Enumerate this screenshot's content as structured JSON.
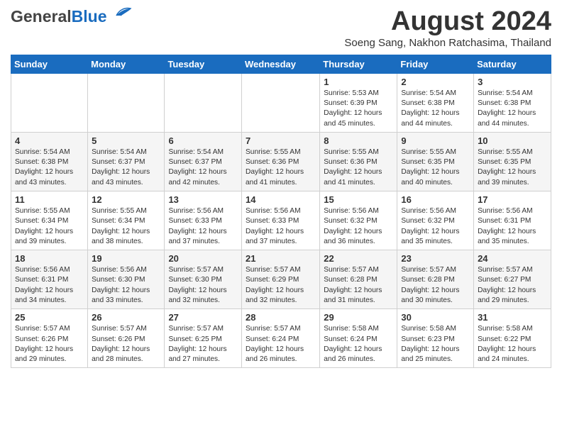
{
  "header": {
    "logo_general": "General",
    "logo_blue": "Blue",
    "month_year": "August 2024",
    "location": "Soeng Sang, Nakhon Ratchasima, Thailand"
  },
  "weekdays": [
    "Sunday",
    "Monday",
    "Tuesday",
    "Wednesday",
    "Thursday",
    "Friday",
    "Saturday"
  ],
  "weeks": [
    [
      {
        "day": "",
        "info": ""
      },
      {
        "day": "",
        "info": ""
      },
      {
        "day": "",
        "info": ""
      },
      {
        "day": "",
        "info": ""
      },
      {
        "day": "1",
        "info": "Sunrise: 5:53 AM\nSunset: 6:39 PM\nDaylight: 12 hours\nand 45 minutes."
      },
      {
        "day": "2",
        "info": "Sunrise: 5:54 AM\nSunset: 6:38 PM\nDaylight: 12 hours\nand 44 minutes."
      },
      {
        "day": "3",
        "info": "Sunrise: 5:54 AM\nSunset: 6:38 PM\nDaylight: 12 hours\nand 44 minutes."
      }
    ],
    [
      {
        "day": "4",
        "info": "Sunrise: 5:54 AM\nSunset: 6:38 PM\nDaylight: 12 hours\nand 43 minutes."
      },
      {
        "day": "5",
        "info": "Sunrise: 5:54 AM\nSunset: 6:37 PM\nDaylight: 12 hours\nand 43 minutes."
      },
      {
        "day": "6",
        "info": "Sunrise: 5:54 AM\nSunset: 6:37 PM\nDaylight: 12 hours\nand 42 minutes."
      },
      {
        "day": "7",
        "info": "Sunrise: 5:55 AM\nSunset: 6:36 PM\nDaylight: 12 hours\nand 41 minutes."
      },
      {
        "day": "8",
        "info": "Sunrise: 5:55 AM\nSunset: 6:36 PM\nDaylight: 12 hours\nand 41 minutes."
      },
      {
        "day": "9",
        "info": "Sunrise: 5:55 AM\nSunset: 6:35 PM\nDaylight: 12 hours\nand 40 minutes."
      },
      {
        "day": "10",
        "info": "Sunrise: 5:55 AM\nSunset: 6:35 PM\nDaylight: 12 hours\nand 39 minutes."
      }
    ],
    [
      {
        "day": "11",
        "info": "Sunrise: 5:55 AM\nSunset: 6:34 PM\nDaylight: 12 hours\nand 39 minutes."
      },
      {
        "day": "12",
        "info": "Sunrise: 5:55 AM\nSunset: 6:34 PM\nDaylight: 12 hours\nand 38 minutes."
      },
      {
        "day": "13",
        "info": "Sunrise: 5:56 AM\nSunset: 6:33 PM\nDaylight: 12 hours\nand 37 minutes."
      },
      {
        "day": "14",
        "info": "Sunrise: 5:56 AM\nSunset: 6:33 PM\nDaylight: 12 hours\nand 37 minutes."
      },
      {
        "day": "15",
        "info": "Sunrise: 5:56 AM\nSunset: 6:32 PM\nDaylight: 12 hours\nand 36 minutes."
      },
      {
        "day": "16",
        "info": "Sunrise: 5:56 AM\nSunset: 6:32 PM\nDaylight: 12 hours\nand 35 minutes."
      },
      {
        "day": "17",
        "info": "Sunrise: 5:56 AM\nSunset: 6:31 PM\nDaylight: 12 hours\nand 35 minutes."
      }
    ],
    [
      {
        "day": "18",
        "info": "Sunrise: 5:56 AM\nSunset: 6:31 PM\nDaylight: 12 hours\nand 34 minutes."
      },
      {
        "day": "19",
        "info": "Sunrise: 5:56 AM\nSunset: 6:30 PM\nDaylight: 12 hours\nand 33 minutes."
      },
      {
        "day": "20",
        "info": "Sunrise: 5:57 AM\nSunset: 6:30 PM\nDaylight: 12 hours\nand 32 minutes."
      },
      {
        "day": "21",
        "info": "Sunrise: 5:57 AM\nSunset: 6:29 PM\nDaylight: 12 hours\nand 32 minutes."
      },
      {
        "day": "22",
        "info": "Sunrise: 5:57 AM\nSunset: 6:28 PM\nDaylight: 12 hours\nand 31 minutes."
      },
      {
        "day": "23",
        "info": "Sunrise: 5:57 AM\nSunset: 6:28 PM\nDaylight: 12 hours\nand 30 minutes."
      },
      {
        "day": "24",
        "info": "Sunrise: 5:57 AM\nSunset: 6:27 PM\nDaylight: 12 hours\nand 29 minutes."
      }
    ],
    [
      {
        "day": "25",
        "info": "Sunrise: 5:57 AM\nSunset: 6:26 PM\nDaylight: 12 hours\nand 29 minutes."
      },
      {
        "day": "26",
        "info": "Sunrise: 5:57 AM\nSunset: 6:26 PM\nDaylight: 12 hours\nand 28 minutes."
      },
      {
        "day": "27",
        "info": "Sunrise: 5:57 AM\nSunset: 6:25 PM\nDaylight: 12 hours\nand 27 minutes."
      },
      {
        "day": "28",
        "info": "Sunrise: 5:57 AM\nSunset: 6:24 PM\nDaylight: 12 hours\nand 26 minutes."
      },
      {
        "day": "29",
        "info": "Sunrise: 5:58 AM\nSunset: 6:24 PM\nDaylight: 12 hours\nand 26 minutes."
      },
      {
        "day": "30",
        "info": "Sunrise: 5:58 AM\nSunset: 6:23 PM\nDaylight: 12 hours\nand 25 minutes."
      },
      {
        "day": "31",
        "info": "Sunrise: 5:58 AM\nSunset: 6:22 PM\nDaylight: 12 hours\nand 24 minutes."
      }
    ]
  ]
}
